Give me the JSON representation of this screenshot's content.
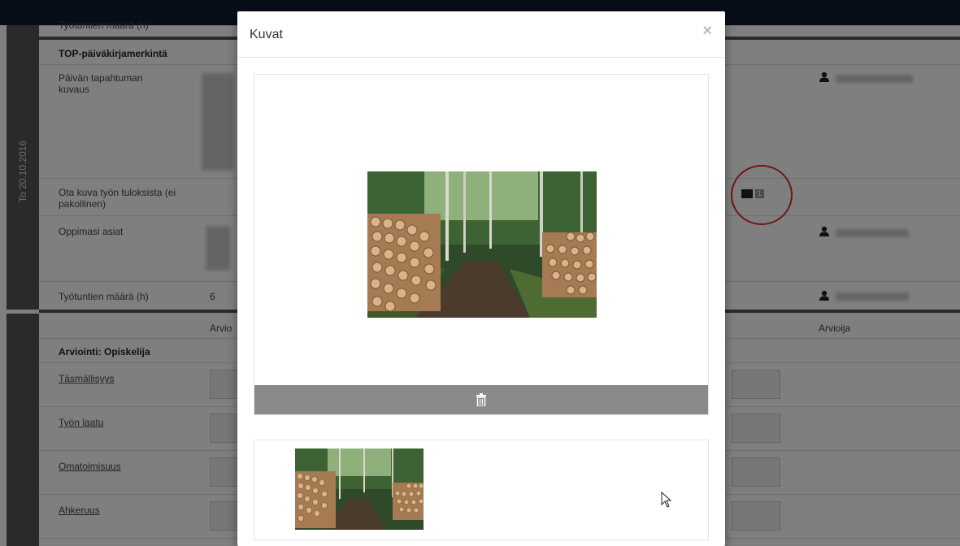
{
  "navbar": {
    "brand": ""
  },
  "page": {
    "date_label": "To 20.10.2016",
    "rows": {
      "top_hidden": "Työtuntien määrä (h)",
      "diary_heading": "TOP-päiväkirjamerkintä",
      "event_label": "Päivän tapahtuman kuvaus",
      "photo_label": "Ota kuva työn tuloksista (ei pakollinen)",
      "learned_label": "Oppimasi asiat",
      "hours_label": "Työtuntien määrä (h)",
      "hours_value": "6",
      "assessment_col": "Arvio",
      "assessor_col": "Arvioija",
      "assessment_heading": "Arviointi: Opiskelija",
      "criteria": [
        "Täsmällisyys",
        "Työn laatu",
        "Omatoimisuus",
        "Ahkeruus"
      ]
    },
    "image_count": "1"
  },
  "modal": {
    "title": "Kuvat",
    "close": "×"
  },
  "icons": {
    "user": "user-icon",
    "image": "image-icon",
    "trash": "trash-icon",
    "close": "close-icon",
    "cursor": "mouse-cursor-icon"
  },
  "colors": {
    "navbar": "#0f1d33",
    "date_column": "#555555",
    "delete_bar": "#8a8a8a",
    "highlight_circle": "#e0282b"
  }
}
